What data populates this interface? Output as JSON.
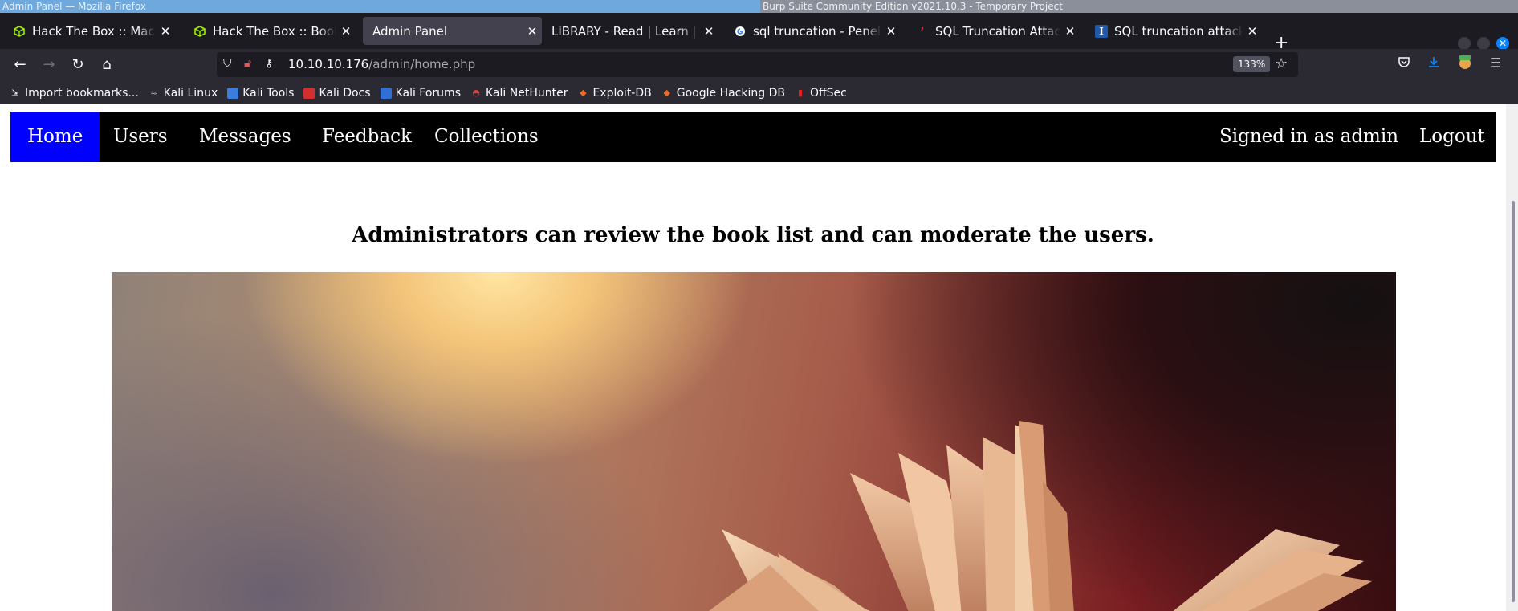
{
  "os": {
    "left_title": "Admin Panel — Mozilla Firefox",
    "right_title": "Burp Suite Community Edition v2021.10.3 - Temporary Project"
  },
  "tabs": [
    {
      "title": "Hack The Box :: Machines",
      "icon": "htb-cube-icon",
      "active": false
    },
    {
      "title": "Hack The Box :: Book",
      "icon": "htb-cube-icon",
      "active": false
    },
    {
      "title": "Admin Panel",
      "icon": "",
      "active": true
    },
    {
      "title": "LIBRARY - Read | Learn | Have Fun",
      "icon": "",
      "active": false
    },
    {
      "title": "sql truncation - Penelusuran Google",
      "icon": "google-icon",
      "active": false
    },
    {
      "title": "SQL Truncation Attack",
      "icon": "quote-icon",
      "active": false
    },
    {
      "title": "SQL truncation attack - Infosec",
      "icon": "infosec-icon",
      "active": false
    }
  ],
  "urlbar": {
    "host": "10.10.10.176",
    "path": "/admin/home.php",
    "zoom": "133%"
  },
  "bookmarks": [
    "Import bookmarks...",
    "Kali Linux",
    "Kali Tools",
    "Kali Docs",
    "Kali Forums",
    "Kali NetHunter",
    "Exploit-DB",
    "Google Hacking DB",
    "OffSec"
  ],
  "site_nav": {
    "home": "Home",
    "users": "Users",
    "messages": "Messages",
    "feedback": "Feedback",
    "collections": "Collections",
    "signed_in": "Signed in as admin",
    "logout": "Logout",
    "active_color": "#0000ff"
  },
  "main": {
    "headline": "Administrators can review the book list and can moderate the users."
  },
  "colors": {
    "accent": "#0a84ff",
    "nav_bg": "#000000"
  }
}
